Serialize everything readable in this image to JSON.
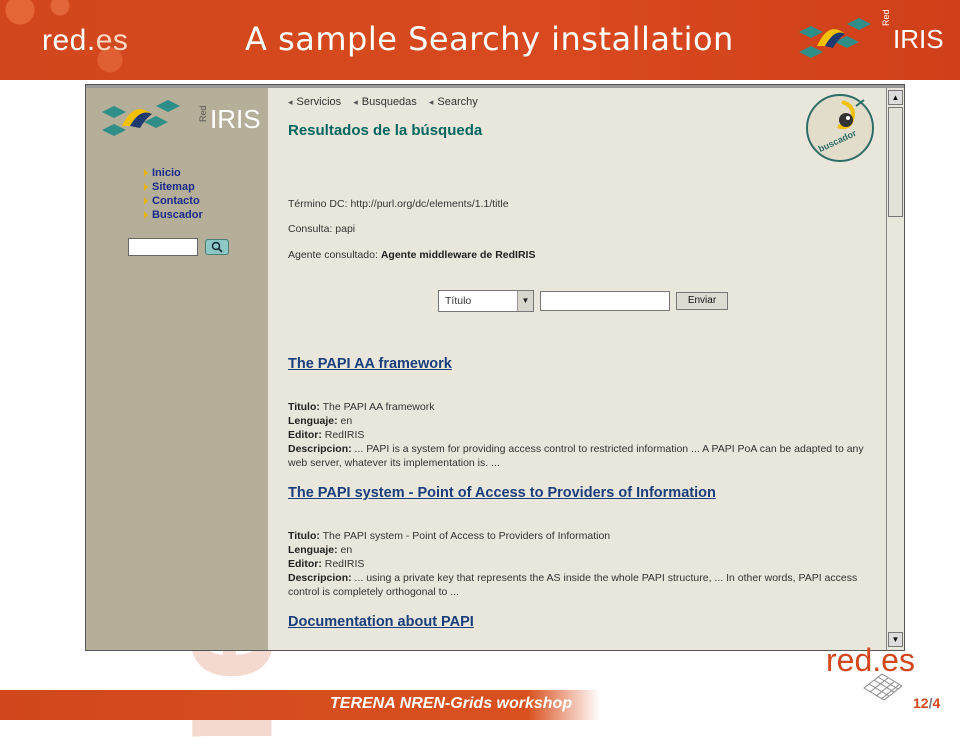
{
  "slide": {
    "logo_left": "red",
    "logo_left_es": "es",
    "logo_left_dot": ".",
    "title": "A sample Searchy installation",
    "rediris_red": "Red",
    "rediris_iris": "IRIS",
    "watermark": "red.es",
    "footer": "TERENA NREN-Grids workshop",
    "bottom_logo": "red.es",
    "page_current": "12",
    "page_sep": "/",
    "page_total": "4"
  },
  "colors": {
    "brand_orange": "#d2471d",
    "sidebar": "#b5ae98",
    "content_bg": "#e9e7db",
    "link": "#1a3d7c",
    "heading_teal": "#00665f",
    "nav_link": "#1a2a8c"
  },
  "browser": {
    "sidebar": {
      "logo_red": "Red",
      "logo_iris": "IRIS",
      "nav": [
        "Inicio",
        "Sitemap",
        "Contacto",
        "Buscador"
      ],
      "search_button_icon": "magnifier-icon"
    },
    "breadcrumbs": [
      "Servicios",
      "Busquedas",
      "Searchy"
    ],
    "heading": "Resultados de la búsqueda",
    "badge_text": "buscador",
    "termino_label": "Término DC:",
    "termino_value": "http://purl.org/dc/elements/1.1/title",
    "consulta_label": "Consulta:",
    "consulta_value": "papi",
    "agente_label": "Agente consultado:",
    "agente_value": "Agente middleware de RedIRIS",
    "form": {
      "select_value": "Título",
      "input_value": "",
      "submit_label": "Enviar"
    },
    "results": [
      {
        "title": "The PAPI AA framework",
        "titulo_label": "Titulo:",
        "titulo": "The PAPI AA framework",
        "lenguaje_label": "Lenguaje:",
        "lenguaje": "en",
        "editor_label": "Editor:",
        "editor": "RedIRIS",
        "descripcion_label": "Descripcion:",
        "descripcion": "... PAPI is a system for providing access control to restricted information ... A PAPI PoA can be adapted to any web server, whatever its implementation is. ..."
      },
      {
        "title": "The PAPI system - Point of Access to Providers of Information",
        "titulo_label": "Titulo:",
        "titulo": "The PAPI system - Point of Access to Providers of Information",
        "lenguaje_label": "Lenguaje:",
        "lenguaje": "en",
        "editor_label": "Editor:",
        "editor": "RedIRIS",
        "descripcion_label": "Descripcion:",
        "descripcion": "... using a private key that represents the AS inside the whole PAPI structure, ... In other words, PAPI access control is completely orthogonal to ..."
      },
      {
        "title": "Documentation about PAPI"
      }
    ],
    "scroll_up_icon": "arrow-up-icon",
    "scroll_down_icon": "arrow-down-icon"
  }
}
